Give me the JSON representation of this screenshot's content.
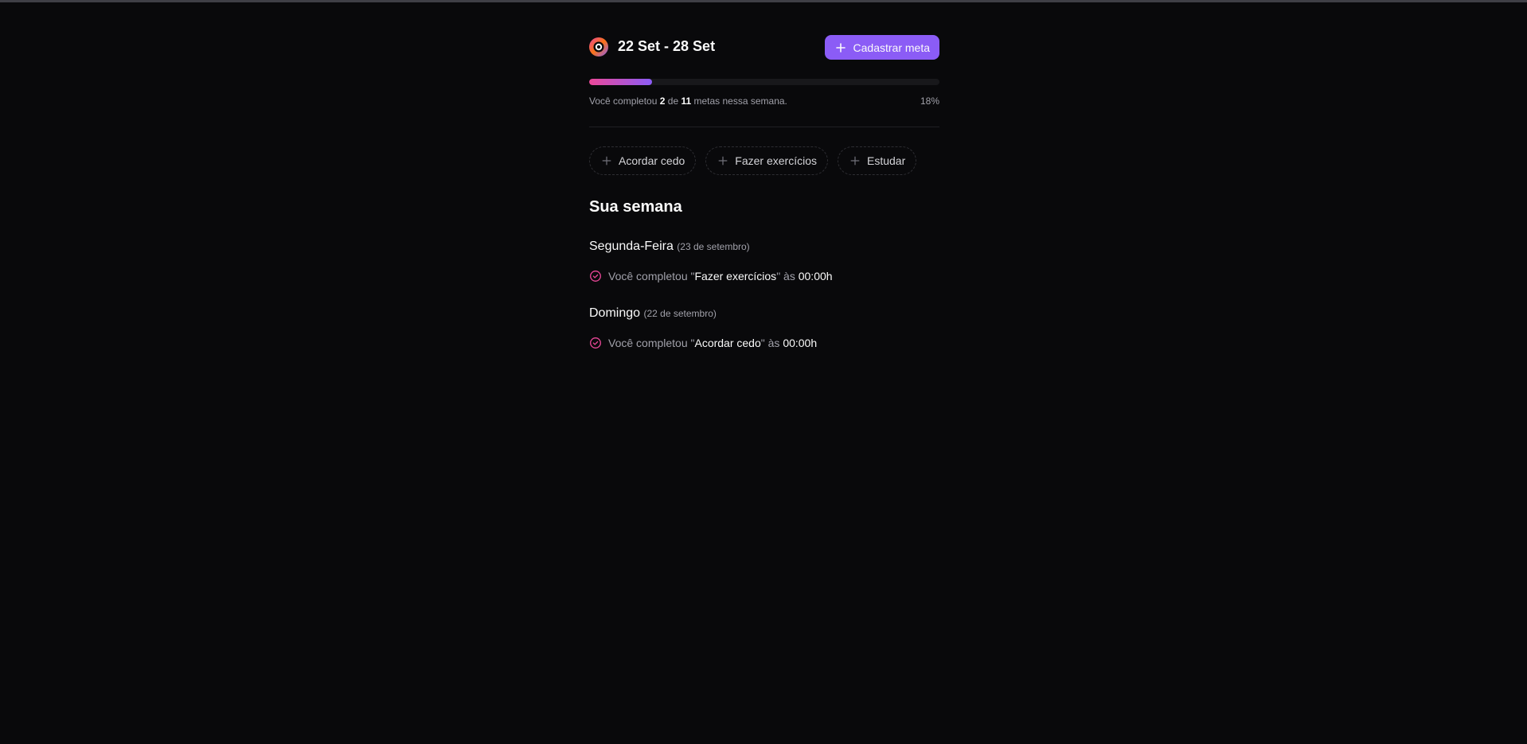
{
  "header": {
    "week_range": "22 Set - 28 Set",
    "add_goal_label": "Cadastrar meta"
  },
  "progress": {
    "prefix": "Você completou",
    "completed": "2",
    "between": "de",
    "total": "11",
    "suffix": "metas nessa semana.",
    "percent_label": "18%",
    "fraction": 0.18
  },
  "pending_goals": [
    {
      "label": "Acordar cedo"
    },
    {
      "label": "Fazer exercícios"
    },
    {
      "label": "Estudar"
    }
  ],
  "summary": {
    "title": "Sua semana",
    "days": [
      {
        "day": "Segunda-Feira",
        "date": "(23 de setembro)",
        "entries": [
          {
            "prefix": "Você completou \"",
            "goal": "Fazer exercícios",
            "middle": "\" às ",
            "time": "00:00h"
          }
        ]
      },
      {
        "day": "Domingo",
        "date": "(22 de setembro)",
        "entries": [
          {
            "prefix": "Você completou \"",
            "goal": "Acordar cedo",
            "middle": "\" às ",
            "time": "00:00h"
          }
        ]
      }
    ]
  },
  "colors": {
    "background": "#09090b",
    "accent": "#8b5cf6",
    "pink": "#ec4899",
    "muted_text": "#a1a1aa"
  },
  "icons": {
    "logo": "in-orbit-logo-icon",
    "add": "plus-icon",
    "completed": "circle-check-icon"
  }
}
